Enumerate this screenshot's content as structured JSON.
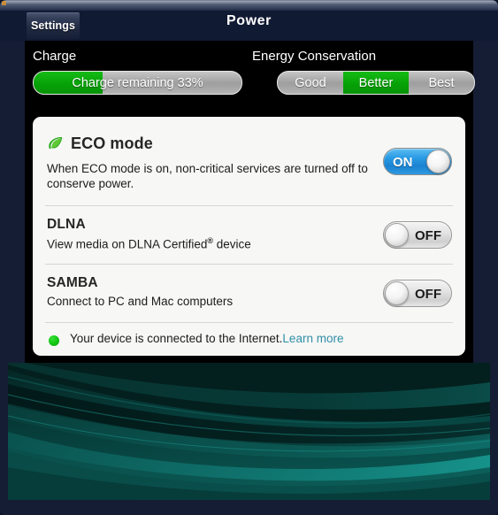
{
  "window": {
    "tab_label": "Settings",
    "page_title": "Power"
  },
  "status": {
    "charge": {
      "label": "Charge",
      "bar_text": "Charge remaining 33%",
      "percent": 33,
      "fill_color": "#06a206",
      "track_color": "#9e9e9e"
    },
    "energy_conservation": {
      "label": "Energy Conservation",
      "options": [
        "Good",
        "Better",
        "Best"
      ],
      "selected": "Better",
      "selected_color": "#06a206"
    }
  },
  "card": {
    "eco": {
      "icon": "leaf-icon",
      "title": "ECO mode",
      "description": "When ECO mode is on, non-critical services are turned off to conserve power.",
      "toggle": "ON",
      "toggle_state": "on",
      "toggle_on_color": "#1b83d2"
    },
    "dlna": {
      "title": "DLNA",
      "description_before": "View media on DLNA Certified",
      "description_sup": "®",
      "description_after": " device",
      "toggle": "OFF",
      "toggle_state": "off"
    },
    "samba": {
      "title": "SAMBA",
      "description": "Connect to PC and Mac computers",
      "toggle": "OFF",
      "toggle_state": "off"
    },
    "internet_status": {
      "indicator": "status-dot-green",
      "indicator_color": "#11c511",
      "text": "Your device is connected to the Internet.",
      "link_label": "Learn more",
      "link_color": "#2f8fa8"
    }
  }
}
